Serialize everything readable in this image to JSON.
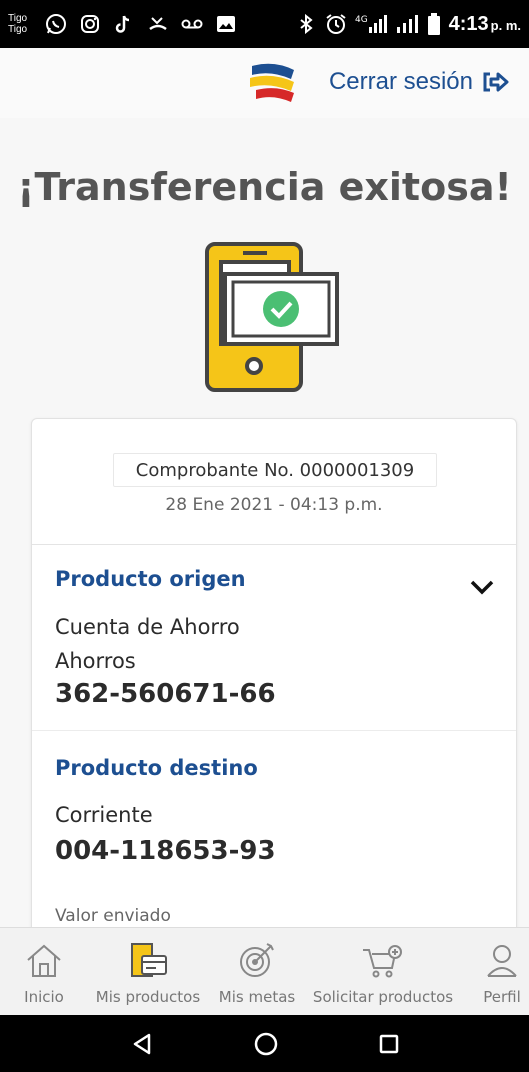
{
  "status_bar": {
    "carrier_line1": "Tigo",
    "carrier_line2": "Tigo",
    "network": "4G",
    "time": "4:13",
    "time_suffix": "p. m."
  },
  "header": {
    "logout_label": "Cerrar sesión"
  },
  "title": "¡Transferencia exitosa!",
  "receipt": {
    "number_label": "Comprobante No. 0000001309",
    "date": "28 Ene 2021 - 04:13 p.m."
  },
  "origin": {
    "title": "Producto origen",
    "account_type": "Cuenta de Ahorro",
    "account_subtype": "Ahorros",
    "account_number": "362-560671-66"
  },
  "destination": {
    "title": "Producto destino",
    "account_type": "Corriente",
    "account_number": "004-118653-93",
    "amount_label": "Valor enviado"
  },
  "bottom_nav": {
    "items": [
      {
        "label": "Inicio",
        "icon": "home-icon"
      },
      {
        "label": "Mis productos",
        "icon": "products-icon"
      },
      {
        "label": "Mis metas",
        "icon": "target-icon"
      },
      {
        "label": "Solicitar productos",
        "icon": "cart-add-icon"
      },
      {
        "label": "Perfil",
        "icon": "user-icon"
      }
    ]
  },
  "colors": {
    "brand_blue": "#1d4f91",
    "brand_yellow": "#f5c518",
    "brand_red": "#d62828",
    "success_green": "#4bbf73"
  }
}
